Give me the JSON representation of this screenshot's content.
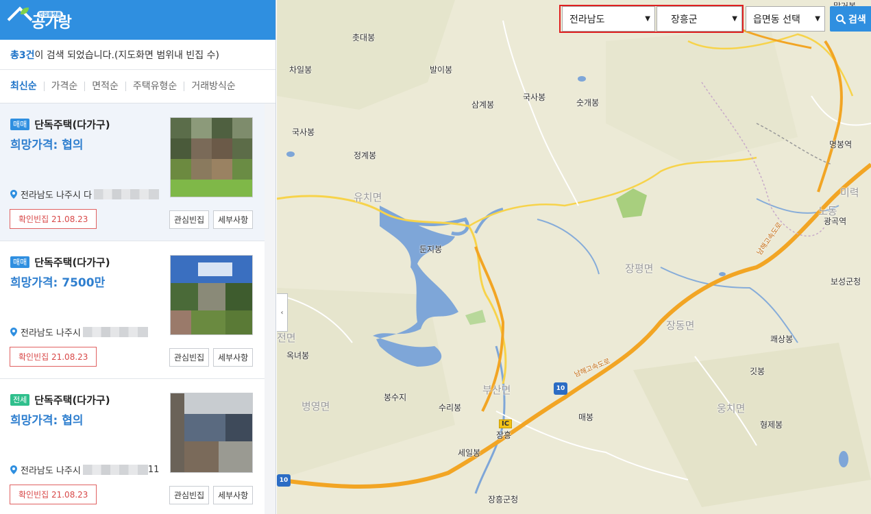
{
  "logo": {
    "text": "공가랑",
    "sub": "빈집플랫폼"
  },
  "summary": {
    "prefix": "총 ",
    "count": "3건",
    "suffix": "이 검색 되었습니다.(지도화면 범위내 빈집 수)"
  },
  "sort_options": [
    "최신순",
    "가격순",
    "면적순",
    "주택유형순",
    "거래방식순"
  ],
  "listings": [
    {
      "badge": "매매",
      "type": "단독주택(다가구)",
      "price": "희망가격: 협의",
      "address": "전라남도 나주시 다",
      "confirm": "확인빈집 21.08.23",
      "fav_label": "관심빈집",
      "detail_label": "세부사항"
    },
    {
      "badge": "매매",
      "type": "단독주택(다가구)",
      "price": "희망가격: 7500만",
      "address": "전라남도 나주시",
      "confirm": "확인빈집 21.08.23",
      "fav_label": "관심빈집",
      "detail_label": "세부사항"
    },
    {
      "badge": "전세",
      "type": "단독주택(다가구)",
      "price": "희망가격: 협의",
      "address": "전라남도 나주시",
      "address_tail": "11",
      "confirm": "확인빈집 21.08.23",
      "fav_label": "관심빈집",
      "detail_label": "세부사항"
    }
  ],
  "map_controls": {
    "province": "전라남도",
    "county": "장흥군",
    "town_placeholder": "읍면동 선택",
    "search_label": "검색"
  },
  "map_labels": {
    "l1": "촛대봉",
    "l2": "차일봉",
    "l3": "발이봉",
    "l4": "국사봉",
    "l5": "삼계봉",
    "l6": "숫개봉",
    "l7": "국사봉",
    "l8": "정계봉",
    "l9": "유치면",
    "l10": "둔지봉",
    "l11": "장평면",
    "l12": "장동면",
    "l13": "명봉역",
    "l14": "광곡역",
    "l15": "보성군청",
    "l16": "쾌상봉",
    "l17": "옥녀봉",
    "l18": "깃봉",
    "l19": "봉수지",
    "l20": "수리봉",
    "l21": "부산면",
    "l22": "병영면",
    "l23": "매봉",
    "l24": "웅치면",
    "l25": "형제봉",
    "l26": "장흥",
    "l27": "세일봉",
    "l28": "장흥군청",
    "l29": "남해고속도로",
    "l30": "남해고속도로",
    "l31": "전면",
    "l32": "미력",
    "l33": "노동",
    "l34": "말거봉"
  },
  "map_badges": {
    "ic": "IC",
    "hw10": "10",
    "hw10b": "10"
  },
  "colors": {
    "brand": "#2f8fe0",
    "highlight": "#e02020",
    "water": "#7ea6d8",
    "highway": "#f2a524"
  }
}
